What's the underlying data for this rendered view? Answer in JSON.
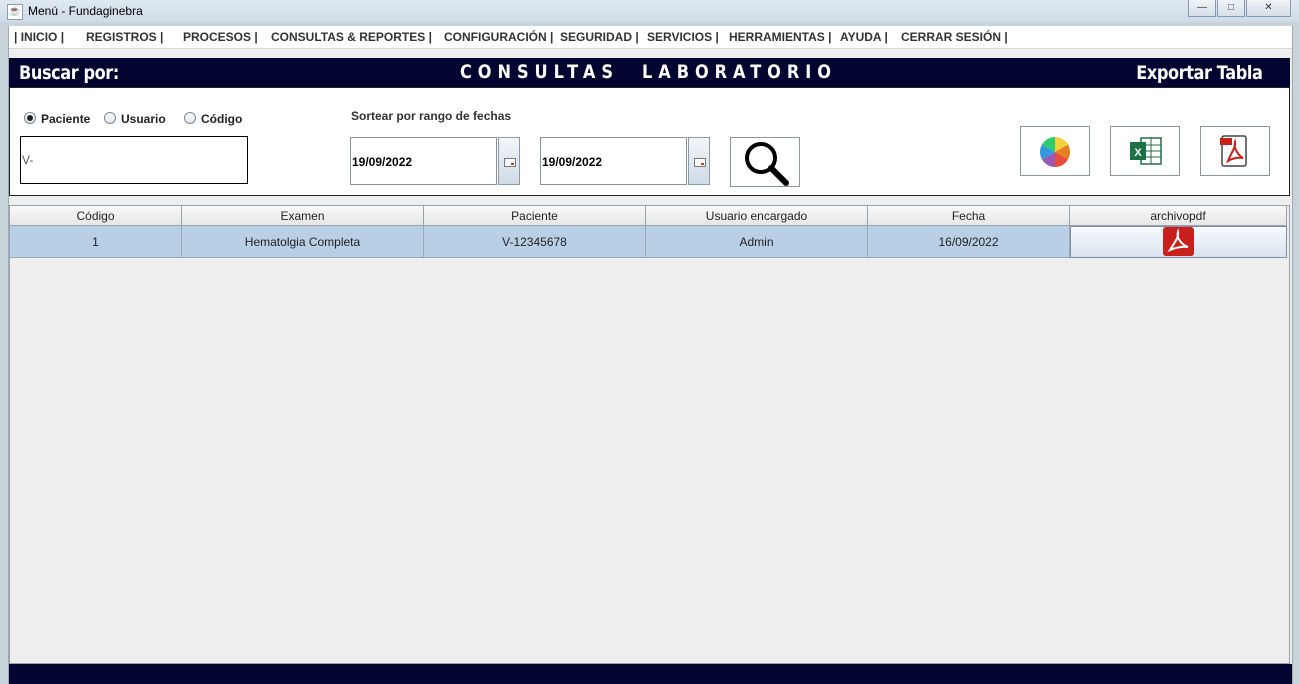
{
  "window": {
    "title": "Menú - Fundaginebra",
    "min_glyph": "—",
    "max_glyph": "□",
    "close_glyph": "✕"
  },
  "menu": [
    "| INICIO  |",
    "REGISTROS  |",
    "PROCESOS  |",
    "CONSULTAS & REPORTES  |",
    "CONFIGURACIÓN  |",
    "SEGURIDAD  |",
    "SERVICIOS  |",
    "HERRAMIENTAS  |",
    "AYUDA  |",
    "CERRAR SESIÓN  |"
  ],
  "header": {
    "search_by": "Buscar por:",
    "title_part1": "CONSULTAS",
    "title_part2": "LABORATORIO",
    "export": "Exportar Tabla"
  },
  "filters": {
    "options": [
      "Paciente",
      "Usuario",
      "Código"
    ],
    "selected": "Paciente",
    "search_value": "V-",
    "range_label": "Sortear por rango de fechas",
    "date_from": "19/09/2022",
    "date_to": "19/09/2022"
  },
  "icons": {
    "search": "magnifier-icon",
    "chart": "pie-chart-icon",
    "excel": "excel-icon",
    "pdf": "pdf-icon",
    "calendar": "calendar-icon"
  },
  "table": {
    "columns": [
      "Código",
      "Examen",
      "Paciente",
      "Usuario encargado",
      "Fecha",
      "archivopdf"
    ],
    "rows": [
      {
        "codigo": "1",
        "examen": "Hematolgia Completa",
        "paciente": "V-12345678",
        "usuario": "Admin",
        "fecha": "16/09/2022"
      }
    ]
  },
  "colors": {
    "navy": "#020530",
    "row_selected": "#b8cfe5",
    "pdf_red": "#c8201c",
    "excel_green": "#1e7145"
  }
}
